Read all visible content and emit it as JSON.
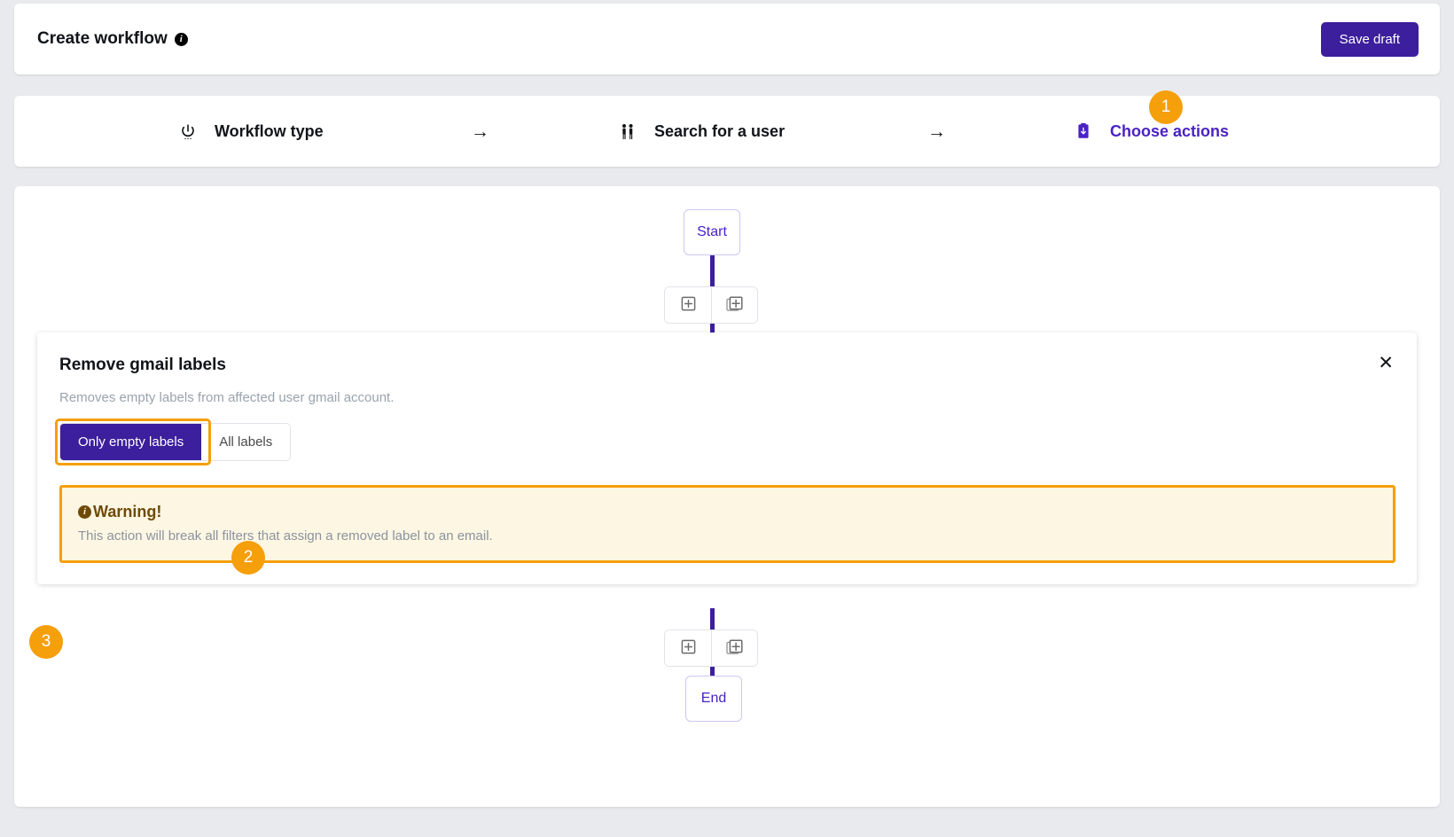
{
  "header": {
    "title": "Create workflow",
    "info_icon": "info-icon",
    "save_label": "Save draft",
    "accent_purple": "#3c1f9c",
    "accent_orange": "#f59f0b"
  },
  "stepper": {
    "steps": [
      {
        "label": "Workflow type",
        "icon": "power-icon",
        "active": false
      },
      {
        "label": "Search for a user",
        "icon": "people-icon",
        "active": false
      },
      {
        "label": "Choose actions",
        "icon": "clipboard-icon",
        "active": true
      }
    ],
    "arrow": "→",
    "badge": "1"
  },
  "flow": {
    "start_label": "Start",
    "end_label": "End",
    "add_icon": "add-square-icon",
    "duplicate_icon": "duplicate-square-icon"
  },
  "panel": {
    "title": "Remove gmail labels",
    "badge": "2",
    "close_icon": "close-icon",
    "subtitle": "Removes empty labels from affected user gmail account.",
    "toggle": {
      "badge": "3",
      "options": [
        {
          "label": "Only empty labels",
          "selected": true
        },
        {
          "label": "All labels",
          "selected": false
        }
      ]
    },
    "warning": {
      "icon": "info-icon",
      "title": "Warning!",
      "body": "This action will break all filters that assign a removed label to an email."
    }
  }
}
